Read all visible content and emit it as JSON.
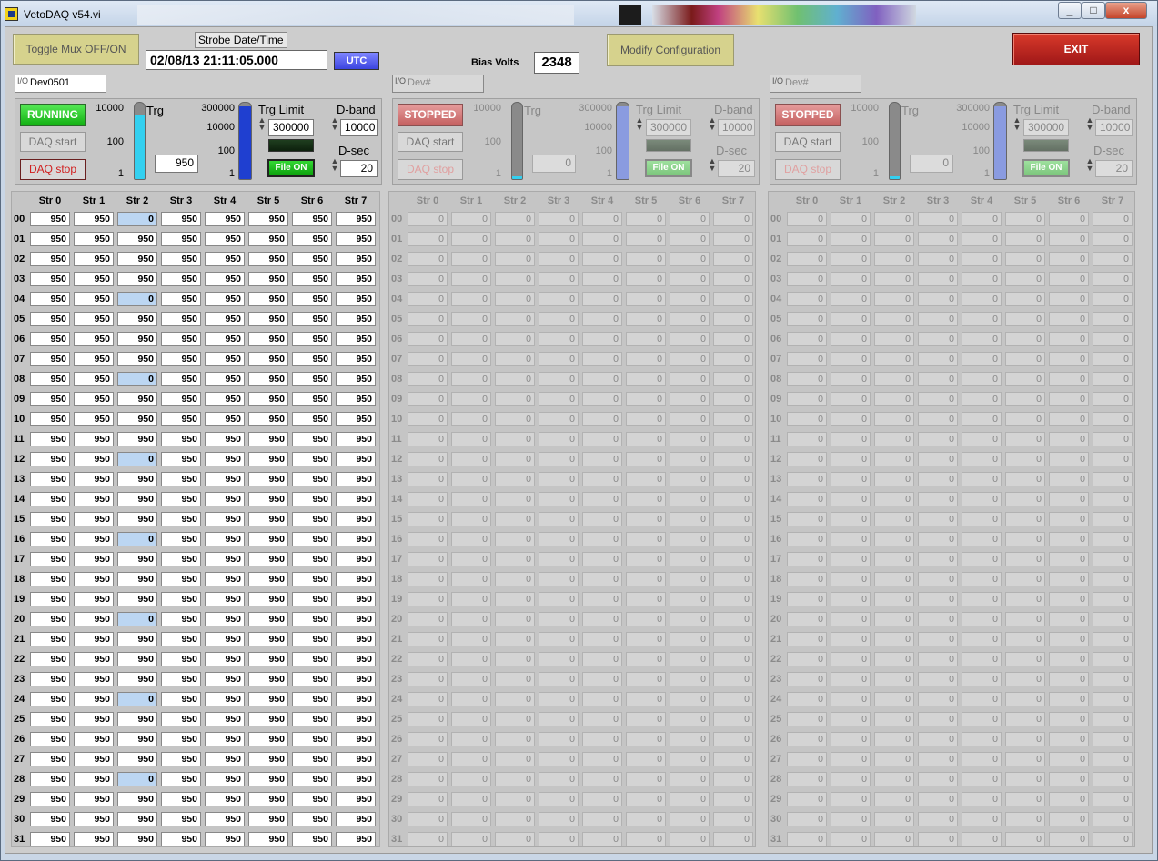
{
  "window": {
    "title": "VetoDAQ v54.vi",
    "min": "_",
    "max": "□",
    "close": "x"
  },
  "top": {
    "toggle_mux_label": "Toggle Mux OFF/ON",
    "strobe_label": "Strobe Date/Time",
    "strobe_value": "02/08/13 21:11:05.000",
    "utc_label": "UTC",
    "bias_label": "Bias Volts",
    "bias_value": "2348",
    "modify_label": "Modify Configuration",
    "exit_label": "EXIT"
  },
  "panels": [
    {
      "device": "Dev0501",
      "io_icon": "I/O",
      "status": "RUNNING",
      "active": true,
      "daq_start": "DAQ start",
      "daq_stop": "DAQ stop",
      "trg_label": "Trg",
      "trg_scale": [
        "10000",
        "100",
        "1"
      ],
      "trg_value": "950",
      "trg_fill_fraction": 0.85,
      "limit_scale": [
        "300000",
        "10000",
        "100",
        "1"
      ],
      "limit_fill_fraction": 0.95,
      "trg_limit_label": "Trg Limit",
      "trg_limit_value": "300000",
      "dband_label": "D-band",
      "dband_value": "10000",
      "dsec_label": "D-sec",
      "dsec_value": "20",
      "file_label": "File ON"
    },
    {
      "device": "Dev#",
      "io_icon": "I/O",
      "status": "STOPPED",
      "active": false,
      "daq_start": "DAQ start",
      "daq_stop": "DAQ stop",
      "trg_label": "Trg",
      "trg_scale": [
        "10000",
        "100",
        "1"
      ],
      "trg_value": "0",
      "trg_fill_fraction": 0.04,
      "limit_scale": [
        "300000",
        "10000",
        "100",
        "1"
      ],
      "limit_fill_fraction": 0.95,
      "trg_limit_label": "Trg Limit",
      "trg_limit_value": "300000",
      "dband_label": "D-band",
      "dband_value": "10000",
      "dsec_label": "D-sec",
      "dsec_value": "20",
      "file_label": "File ON"
    },
    {
      "device": "Dev#",
      "io_icon": "I/O",
      "status": "STOPPED",
      "active": false,
      "daq_start": "DAQ start",
      "daq_stop": "DAQ stop",
      "trg_label": "Trg",
      "trg_scale": [
        "10000",
        "100",
        "1"
      ],
      "trg_value": "0",
      "trg_fill_fraction": 0.04,
      "limit_scale": [
        "300000",
        "10000",
        "100",
        "1"
      ],
      "limit_fill_fraction": 0.95,
      "trg_limit_label": "Trg Limit",
      "trg_limit_value": "300000",
      "dband_label": "D-band",
      "dband_value": "10000",
      "dsec_label": "D-sec",
      "dsec_value": "20",
      "file_label": "File ON"
    }
  ],
  "grid": {
    "columns": [
      "Str 0",
      "Str 1",
      "Str 2",
      "Str 3",
      "Str 4",
      "Str 5",
      "Str 6",
      "Str 7"
    ],
    "rows": [
      "00",
      "01",
      "02",
      "03",
      "04",
      "05",
      "06",
      "07",
      "08",
      "09",
      "10",
      "11",
      "12",
      "13",
      "14",
      "15",
      "16",
      "17",
      "18",
      "19",
      "20",
      "21",
      "22",
      "23",
      "24",
      "25",
      "26",
      "27",
      "28",
      "29",
      "30",
      "31"
    ],
    "active_value": "950",
    "inactive_value": "0",
    "zero_rows_str2": [
      "00",
      "04",
      "08",
      "12",
      "16",
      "20",
      "24",
      "28"
    ]
  },
  "colors": {
    "running": "#12b012",
    "stopped": "#c46060",
    "exit": "#b82020",
    "utc": "#3b44e0",
    "trg_fill": "#33d0f0",
    "limit_fill": "#1f3fd0"
  }
}
